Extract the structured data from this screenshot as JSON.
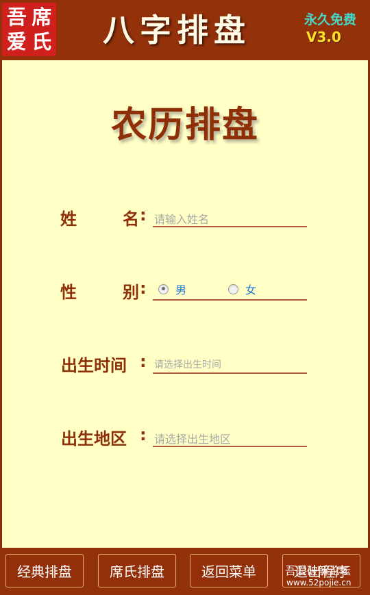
{
  "header": {
    "seal_chars": [
      "吾",
      "席",
      "爱",
      "氏"
    ],
    "app_title": "八字排盘",
    "free_label": "永久免费",
    "version": "V3.0"
  },
  "main": {
    "page_title": "农历排盘",
    "form": {
      "name": {
        "label_a": "姓",
        "label_b": "名",
        "colon": ":",
        "placeholder": "请输入姓名",
        "value": ""
      },
      "gender": {
        "label_a": "性",
        "label_b": "别",
        "colon": ":",
        "options": [
          "男",
          "女"
        ],
        "selected": "男"
      },
      "birth_time": {
        "label": "出生时间",
        "colon": ":",
        "placeholder": "请选择出生时间",
        "value": ""
      },
      "birth_region": {
        "label": "出生地区",
        "colon": ":",
        "placeholder": "请选择出生地区",
        "value": ""
      }
    }
  },
  "footer": {
    "buttons": [
      "经典排盘",
      "席氏排盘",
      "返回菜单",
      "退出程序"
    ],
    "watermark_text": "吾爱破解论坛",
    "watermark_url": "www.52pojie.cn"
  },
  "colors": {
    "brand_brown": "#92310a",
    "background_cream": "#ffffc6",
    "label_brown": "#8e2f08",
    "seal_red": "#d0201d",
    "free_cyan": "#46d8c8",
    "version_yellow": "#ffe12b",
    "radio_text_blue": "#1f78d1"
  }
}
